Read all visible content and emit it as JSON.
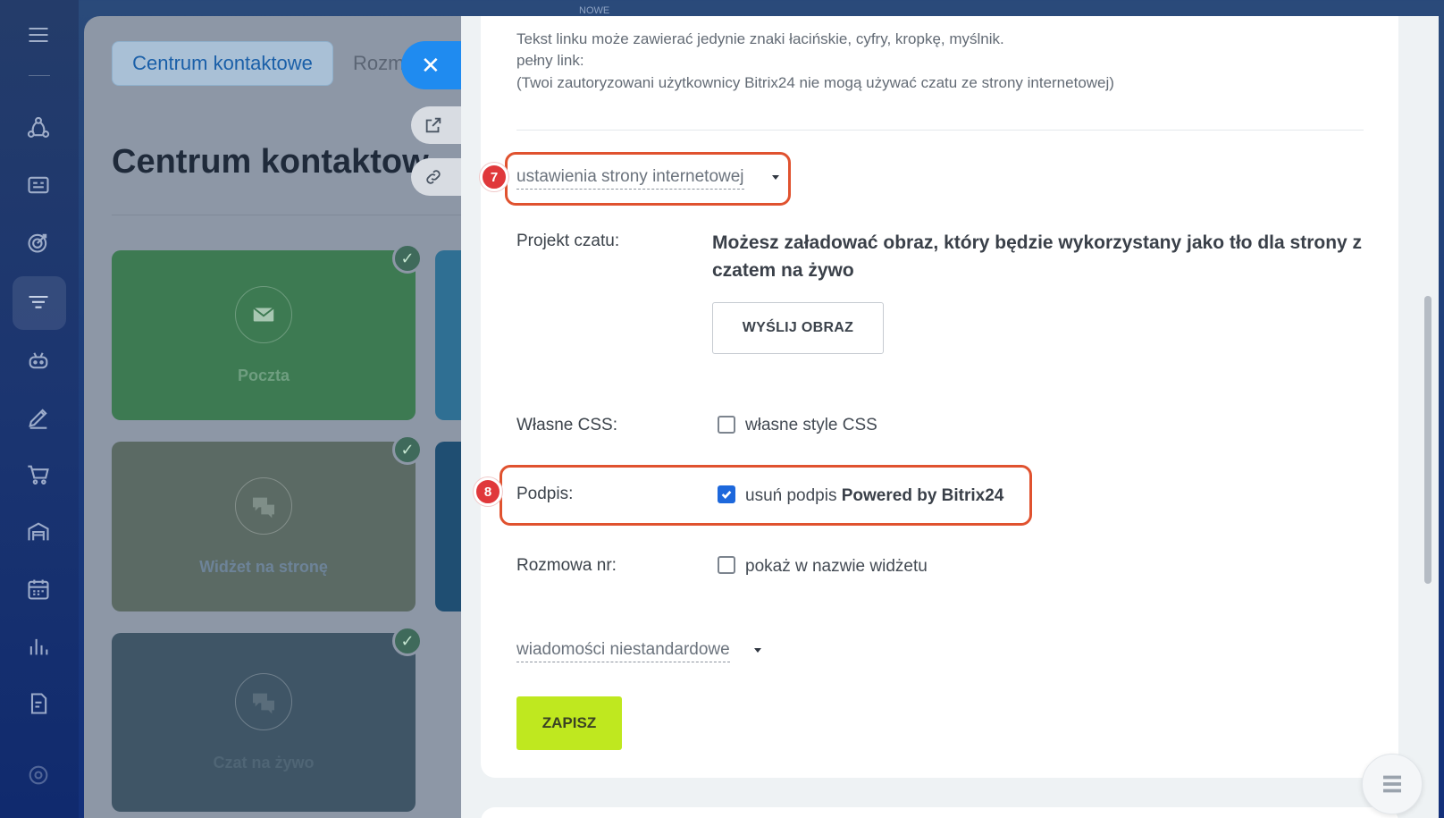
{
  "background": {
    "top_label": "NOWE",
    "tab_active": "Centrum kontaktowe",
    "tab_next": "Rozm",
    "page_title": "Centrum kontaktow",
    "tiles": [
      {
        "label": "Poczta",
        "icon": "mail-icon",
        "color": "#3d7a52"
      },
      {
        "label": "Widżet na stronę",
        "icon": "chat-icon",
        "color": "#5b6a64"
      },
      {
        "label": "Czat na żywo",
        "icon": "chat-icon",
        "color": "#3f5566"
      }
    ]
  },
  "panel": {
    "info": {
      "line1": "Tekst linku może zawierać jedynie znaki łacińskie, cyfry, kropkę, myślnik.",
      "line2": "pełny link:",
      "line3": "(Twoi zautoryzowani użytkownicy Bitrix24 nie mogą używać czatu ze strony internetowej)"
    },
    "website_settings": {
      "label": "ustawienia strony internetowej",
      "badge": "7"
    },
    "chat_design": {
      "label": "Projekt czatu:",
      "description": "Możesz załadować obraz, który będzie wykorzystany jako tło dla strony z czatem na żywo",
      "upload_button": "WYŚLIJ OBRAZ"
    },
    "custom_css": {
      "label": "Własne CSS:",
      "checkbox_text": "własne style CSS",
      "checked": false
    },
    "signature": {
      "label": "Podpis:",
      "checkbox_text": "usuń podpis ",
      "checkbox_bold": "Powered by Bitrix24",
      "checked": true,
      "badge": "8"
    },
    "conversation_no": {
      "label": "Rozmowa nr:",
      "checkbox_text": "pokaż w nazwie widżetu",
      "checked": false
    },
    "custom_messages": {
      "label": "wiadomości niestandardowe"
    },
    "save_button": "ZAPISZ"
  },
  "colors": {
    "accent_blue": "#1f8bf0",
    "save_green": "#bfe81f",
    "highlight": "#e0522f",
    "badge_red": "#e0383b"
  }
}
